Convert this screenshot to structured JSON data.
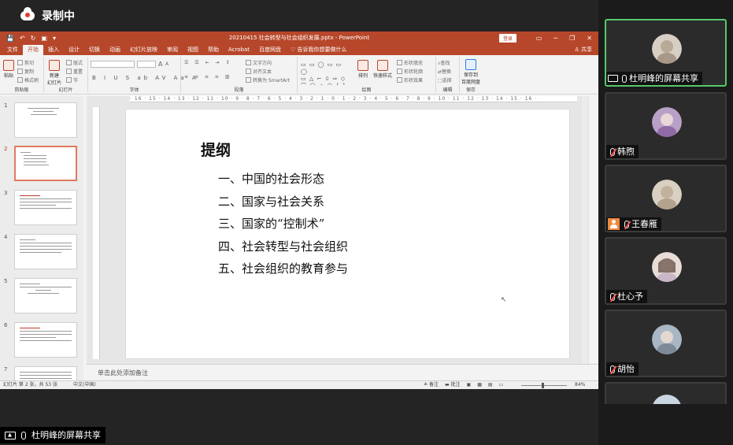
{
  "recording": {
    "label": "录制中"
  },
  "ppt": {
    "window_title": "20210415 社会转型与社会组织发展.pptx - PowerPoint",
    "login_label": "登录",
    "quick_access": [
      "💾",
      "↶",
      "↻",
      "▣",
      "▾"
    ],
    "window_buttons": [
      "▭",
      "─",
      "❐",
      "✕"
    ],
    "tabs": [
      "文件",
      "开始",
      "插入",
      "设计",
      "切换",
      "动画",
      "幻灯片放映",
      "审阅",
      "视图",
      "帮助",
      "Acrobat",
      "百度网盘"
    ],
    "active_tab": "开始",
    "tell_me": "告诉我你想要做什么",
    "share_label": "共享",
    "ribbon": {
      "clipboard": {
        "label": "剪贴板",
        "paste": "粘贴",
        "cut": "剪切",
        "copy": "复制",
        "format_painter": "格式刷"
      },
      "slides": {
        "label": "幻灯片",
        "new_slide_line1": "新建",
        "new_slide_line2": "幻灯片",
        "layout": "版式",
        "reset": "重置",
        "section": "节"
      },
      "font": {
        "label": "字体",
        "size_up": "A",
        "size_down": "A",
        "format_row": "B I U S ab AV Aa A"
      },
      "paragraph": {
        "label": "段落",
        "text_dir": "文字方向",
        "align_text": "对齐文本",
        "smartart": "转换为 SmartArt"
      },
      "drawing": {
        "label": "绘图",
        "arrange": "排列",
        "quick_styles": "快速样式",
        "shape_fill": "形状填充",
        "shape_outline": "形状轮廓",
        "shape_effect": "形状效果"
      },
      "editing": {
        "label": "编辑",
        "find": "查找",
        "replace": "替换",
        "select": "选择"
      },
      "save": {
        "label": "保存",
        "line1": "保存到",
        "line2": "百度网盘"
      }
    },
    "ruler_text": "· 16 · 15 · 14 · 13 · 12 · 11 · 10 · 9 · 8 · 7 · 6 · 5 · 4 · 3 · 2 · 1 · 0 · 1 · 2 · 3 · 4 · 5 · 6 · 7 · 8 · 9 · 10 · 11 · 12 · 13 · 14 · 15 · 16 ·",
    "thumbnails": [
      "1",
      "2",
      "3",
      "4",
      "5",
      "6",
      "7"
    ],
    "selected_thumbnail": "2",
    "slide": {
      "title": "提纲",
      "items": [
        "一、中国的社会形态",
        "二、国家与社会关系",
        "三、国家的“控制术”",
        "四、社会转型与社会组织",
        "五、社会组织的教育参与"
      ]
    },
    "notes_placeholder": "单击此处添加备注",
    "status": {
      "slide_info": "幻灯片 第 2 张，共 53 张",
      "language": "中文(中国)",
      "notes": "备注",
      "comments": "批注",
      "zoom": "84%"
    }
  },
  "presenter_tag": "杜明峰的屏幕共享",
  "participants": [
    {
      "name": "杜明峰的屏幕共享",
      "sharing": true,
      "muted": false,
      "host_icon": false,
      "avatar_color": "#d8cfc4"
    },
    {
      "name": "韩煦",
      "sharing": false,
      "muted": true,
      "host_icon": false,
      "avatar_color": "#b9a0c6"
    },
    {
      "name": "王春雁",
      "sharing": false,
      "muted": true,
      "host_icon": true,
      "avatar_color": "#d9d0c2"
    },
    {
      "name": "杜心予",
      "sharing": false,
      "muted": true,
      "host_icon": false,
      "avatar_color": "#e8dcd6"
    },
    {
      "name": "胡怡",
      "sharing": false,
      "muted": true,
      "host_icon": false,
      "avatar_color": "#a9b6c4"
    }
  ]
}
